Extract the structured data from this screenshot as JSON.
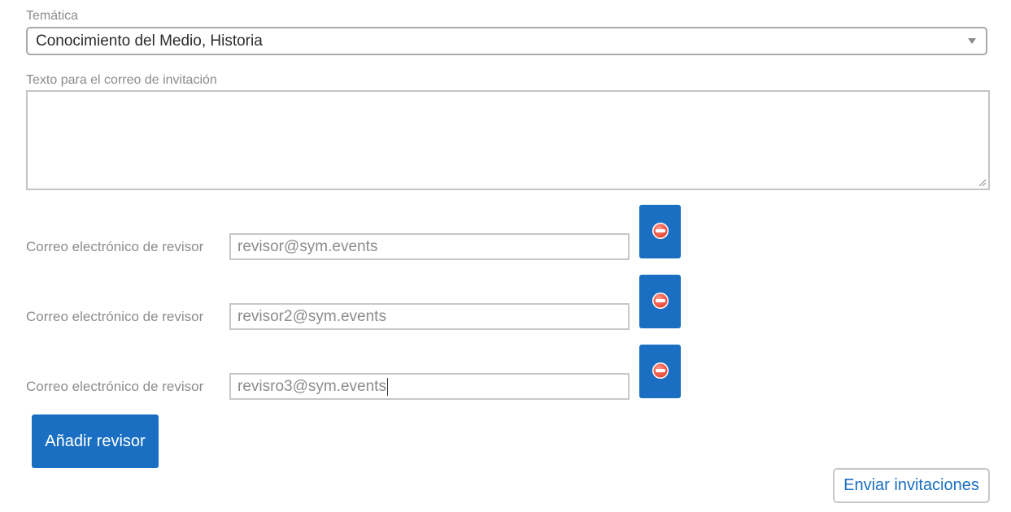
{
  "tematica": {
    "label": "Temática",
    "selected": "Conocimiento del Medio, Historia"
  },
  "invite_text": {
    "label": "Texto para el correo de invitación",
    "value": ""
  },
  "reviewers": [
    {
      "label": "Correo electrónico de revisor",
      "email": "revisor@sym.events"
    },
    {
      "label": "Correo electrónico de revisor",
      "email": "revisor2@sym.events"
    },
    {
      "label": "Correo electrónico de revisor",
      "email": "revisro3@sym.events"
    }
  ],
  "buttons": {
    "add_reviewer": "Añadir revisor",
    "send_invitations": "Enviar invitaciones"
  },
  "icons": {
    "remove": "remove-circle-icon",
    "dropdown": "chevron-down-icon"
  },
  "colors": {
    "primary": "#1a6fc2",
    "label": "#8c8c8c",
    "danger": "#f05a4a"
  }
}
